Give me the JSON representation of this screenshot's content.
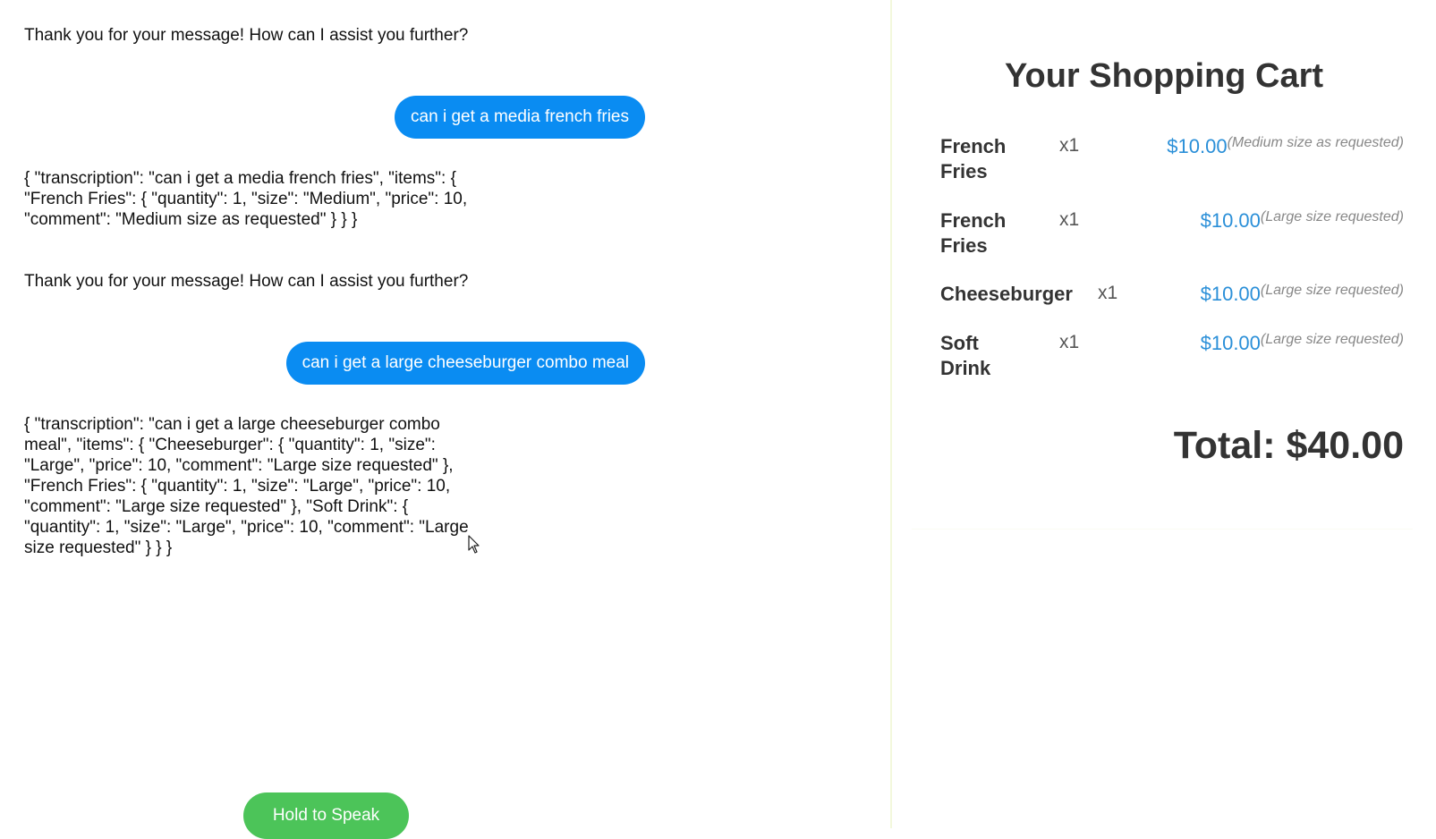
{
  "chat": {
    "messages": [
      {
        "role": "bot",
        "text": "Thank you for your message! How can I assist you further?"
      },
      {
        "role": "user",
        "text": "can i get a media french fries"
      },
      {
        "role": "bot",
        "text": "{ \"transcription\": \"can i get a media french fries\", \"items\": { \"French Fries\": { \"quantity\": 1, \"size\": \"Medium\", \"price\": 10, \"comment\": \"Medium size as requested\" } } }"
      },
      {
        "role": "bot",
        "text": "Thank you for your message! How can I assist you further?"
      },
      {
        "role": "user",
        "text": "can i get a large cheeseburger combo meal"
      },
      {
        "role": "bot",
        "text": "{ \"transcription\": \"can i get a large cheeseburger combo meal\", \"items\": { \"Cheeseburger\": { \"quantity\": 1, \"size\": \"Large\", \"price\": 10, \"comment\": \"Large size requested\" }, \"French Fries\": { \"quantity\": 1, \"size\": \"Large\", \"price\": 10, \"comment\": \"Large size requested\" }, \"Soft Drink\": { \"quantity\": 1, \"size\": \"Large\", \"price\": 10, \"comment\": \"Large size requested\" } } }"
      }
    ],
    "speak_button_label": "Hold to Speak"
  },
  "cart": {
    "title": "Your Shopping Cart",
    "items": [
      {
        "name": "French Fries",
        "qty": "x1",
        "price": "$10.00",
        "comment": "(Medium size as requested)"
      },
      {
        "name": "French Fries",
        "qty": "x1",
        "price": "$10.00",
        "comment": "(Large size requested)"
      },
      {
        "name": "Cheeseburger",
        "qty": "x1",
        "price": "$10.00",
        "comment": "(Large size requested)"
      },
      {
        "name": "Soft Drink",
        "qty": "x1",
        "price": "$10.00",
        "comment": "(Large size requested)"
      }
    ],
    "total": "Total: $40.00"
  },
  "colors": {
    "user_bubble": "#0a8cf2",
    "speak_button": "#4cc459",
    "price": "#2a8fd8",
    "divider": "#f3f8dc"
  },
  "icons": {
    "cursor": "mouse-pointer-icon"
  }
}
